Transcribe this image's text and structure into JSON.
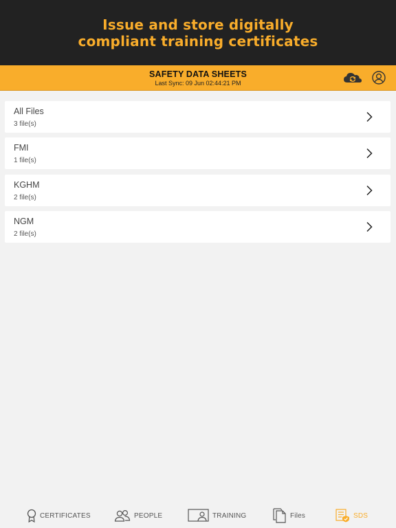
{
  "promo": {
    "line1": "Issue and store digitally",
    "line2": "compliant training certificates"
  },
  "header": {
    "title": "SAFETY DATA SHEETS",
    "last_sync": "Last Sync: 09 Jun 02:44:21 PM",
    "sync_icon": "cloud-sync-icon",
    "profile_icon": "user-profile-icon"
  },
  "folders": [
    {
      "name": "All Files",
      "count": "3 file(s)"
    },
    {
      "name": "FMI",
      "count": "1 file(s)"
    },
    {
      "name": "KGHM",
      "count": "2 file(s)"
    },
    {
      "name": "NGM",
      "count": "2 file(s)"
    }
  ],
  "tabs": [
    {
      "label": "CERTIFICATES",
      "icon": "award-ribbon-icon",
      "active": false
    },
    {
      "label": "PEOPLE",
      "icon": "people-icon",
      "active": false
    },
    {
      "label": "TRAINING",
      "icon": "training-presentation-icon",
      "active": false
    },
    {
      "label": "Files",
      "icon": "files-icon",
      "active": false
    },
    {
      "label": "SDS",
      "icon": "sds-document-icon",
      "active": true
    }
  ],
  "colors": {
    "accent": "#f9ad2b",
    "promo_bg": "#222222",
    "page_bg": "#f2f2f2"
  }
}
